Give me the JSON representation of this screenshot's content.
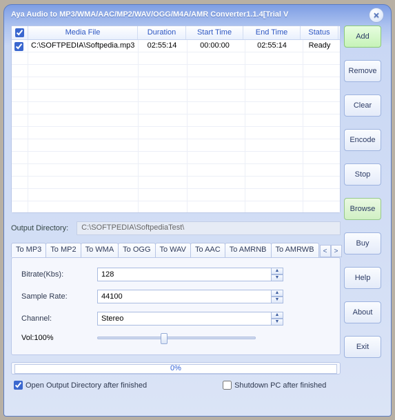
{
  "window": {
    "title": "Aya Audio to MP3/WMA/AAC/MP2/WAV/OGG/M4A/AMR Converter1.1.4[Trial V"
  },
  "side_buttons": {
    "add": "Add",
    "remove": "Remove",
    "clear": "Clear",
    "encode": "Encode",
    "stop": "Stop",
    "browse": "Browse",
    "buy": "Buy",
    "help": "Help",
    "about": "About",
    "exit": "Exit"
  },
  "grid": {
    "headers": {
      "media": "Media File",
      "duration": "Duration",
      "start": "Start Time",
      "end": "End Time",
      "status": "Status"
    },
    "rows": [
      {
        "checked": true,
        "media": "C:\\SOFTPEDIA\\Softpedia.mp3",
        "duration": "02:55:14",
        "start": "00:00:00",
        "end": "02:55:14",
        "status": "Ready"
      }
    ]
  },
  "output": {
    "label": "Output Directory:",
    "value": "C:\\SOFTPEDIA\\SoftpediaTest\\"
  },
  "tabs": [
    "To MP3",
    "To MP2",
    "To WMA",
    "To OGG",
    "To WAV",
    "To AAC",
    "To AMRNB",
    "To AMRWB"
  ],
  "form": {
    "bitrate_label": "Bitrate(Kbs):",
    "bitrate": "128",
    "sample_label": "Sample Rate:",
    "sample": "44100",
    "channel_label": "Channel:",
    "channel": "Stereo",
    "vol_label": "Vol:100%",
    "vol_pct": 40
  },
  "progress": {
    "text": "0%"
  },
  "footer": {
    "open_label": "Open Output Directory after finished",
    "open_checked": true,
    "shutdown_label": "Shutdown PC after finished",
    "shutdown_checked": false
  }
}
